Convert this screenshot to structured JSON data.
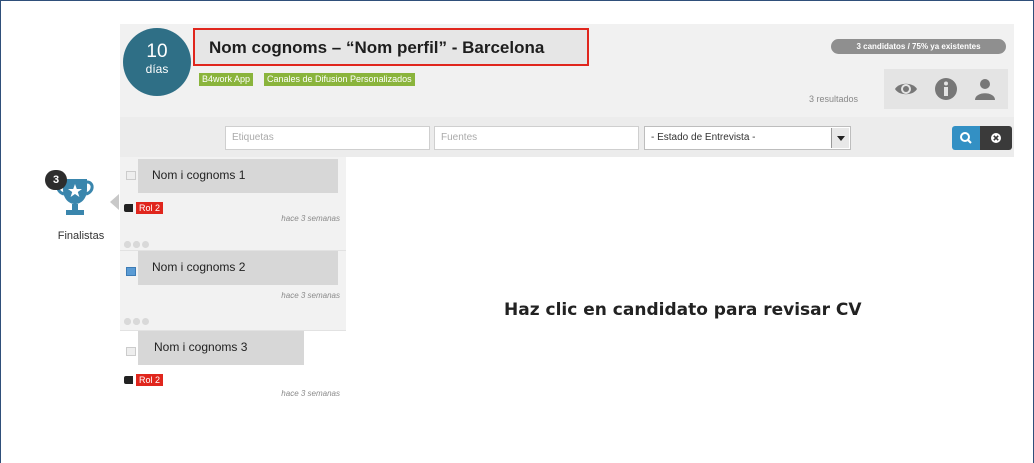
{
  "header": {
    "days_number": "10",
    "days_label": "días",
    "title": "Nom cognoms – “Nom perfil” - Barcelona",
    "tags": [
      "B4work App",
      "Canales de Difusion Personalizados"
    ],
    "count_pill": "3 candidatos / 75% ya existentes",
    "results": "3 resultados",
    "icons": [
      "eye-icon",
      "info-icon",
      "user-icon"
    ]
  },
  "sidebar": {
    "finalists_count": "3",
    "finalists_label": "Finalistas"
  },
  "filters": {
    "etiquetas_placeholder": "Etiquetas",
    "fuentes_placeholder": "Fuentes",
    "estado_selected": "- Estado de Entrevista -"
  },
  "candidates": [
    {
      "name": "Nom i cognoms 1",
      "role": "Rol 2",
      "time": "hace 3 semanas"
    },
    {
      "name": "Nom i cognoms 2",
      "role": "",
      "time": "hace 3 semanas"
    },
    {
      "name": "Nom i cognoms 3",
      "role": "Rol 2",
      "time": "hace 3 semanas"
    }
  ],
  "main": {
    "message": "Haz clic en candidato para revisar CV"
  },
  "colors": {
    "accent_teal": "#2f6f86",
    "tag_green": "#8ab43c",
    "role_red": "#e0261d",
    "highlight_red": "#e0261d",
    "search_blue": "#3390c4"
  }
}
